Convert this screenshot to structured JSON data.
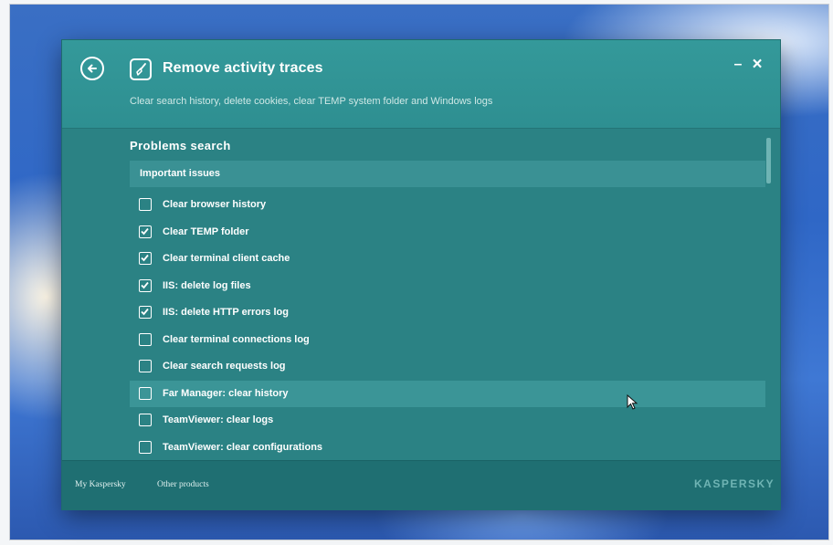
{
  "window": {
    "title": "Remove activity traces",
    "subtitle": "Clear search history, delete cookies, clear TEMP system folder and Windows logs",
    "minimize_label": "–",
    "close_label": "×",
    "back_icon": "arrow-left-circle",
    "title_icon": "broom"
  },
  "content": {
    "section_title": "Problems search",
    "group_title": "Important issues",
    "items": [
      {
        "label": "Clear browser history",
        "checked": false
      },
      {
        "label": "Clear TEMP folder",
        "checked": true
      },
      {
        "label": "Clear terminal client cache",
        "checked": true
      },
      {
        "label": "IIS: delete log files",
        "checked": true
      },
      {
        "label": "IIS: delete HTTP errors log",
        "checked": true
      },
      {
        "label": "Clear terminal connections log",
        "checked": false
      },
      {
        "label": "Clear search requests log",
        "checked": false
      },
      {
        "label": "Far Manager: clear history",
        "checked": false
      },
      {
        "label": "TeamViewer: clear logs",
        "checked": false
      },
      {
        "label": "TeamViewer: clear configurations",
        "checked": false
      }
    ]
  },
  "footer": {
    "my_kaspersky": "My Kaspersky",
    "other_products": "Other products",
    "logo": "KASPERSKY"
  },
  "colors": {
    "window_bg": "#2b8486",
    "header_bg": "#34999a",
    "footer_bg": "#1f6f72",
    "desktop_bg": "#2f67c6"
  }
}
